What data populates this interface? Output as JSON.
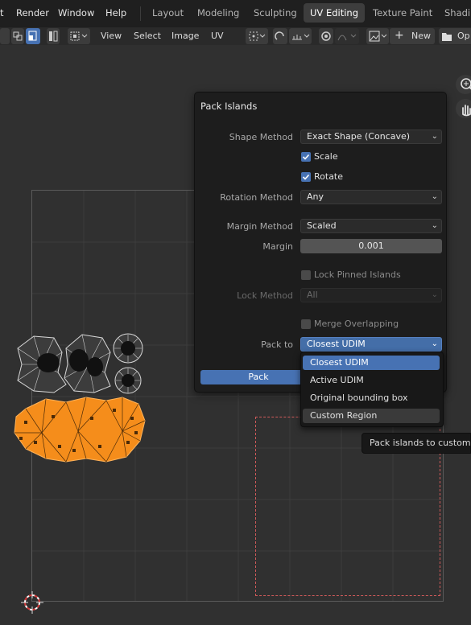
{
  "menubar": {
    "items": [
      "t",
      "Render",
      "Window",
      "Help"
    ],
    "workspaces": [
      "Layout",
      "Modeling",
      "Sculpting",
      "UV Editing",
      "Texture Paint",
      "Shadi"
    ],
    "active_workspace": "UV Editing"
  },
  "header": {
    "menus": [
      "View",
      "Select",
      "Image",
      "UV"
    ],
    "new_label": "New",
    "open_label": "Op"
  },
  "panel": {
    "title": "Pack Islands",
    "shape_method_label": "Shape Method",
    "shape_method_value": "Exact Shape (Concave)",
    "scale_label": "Scale",
    "scale_checked": true,
    "rotate_label": "Rotate",
    "rotate_checked": true,
    "rotation_method_label": "Rotation Method",
    "rotation_method_value": "Any",
    "margin_method_label": "Margin Method",
    "margin_method_value": "Scaled",
    "margin_label": "Margin",
    "margin_value": "0.001",
    "lock_pinned_label": "Lock Pinned Islands",
    "lock_pinned_checked": false,
    "lock_method_label": "Lock Method",
    "lock_method_value": "All",
    "merge_overlapping_label": "Merge Overlapping",
    "merge_overlapping_checked": false,
    "pack_to_label": "Pack to",
    "pack_to_value": "Closest UDIM",
    "pack_button": "Pack"
  },
  "pack_to_menu": {
    "options": [
      "Closest UDIM",
      "Active UDIM",
      "Original bounding box",
      "Custom Region"
    ],
    "selected": "Closest UDIM",
    "hovered": "Custom Region"
  },
  "tooltip": "Pack islands to custom",
  "colors": {
    "accent": "#4772b3",
    "island_selected": "#f58d1b",
    "island_unselected": "#d8d8d8",
    "custom_region_dash": "#d05a5a"
  },
  "icons": [
    "zoom-in-icon",
    "pan-hand-icon",
    "cursor-2d-icon"
  ]
}
